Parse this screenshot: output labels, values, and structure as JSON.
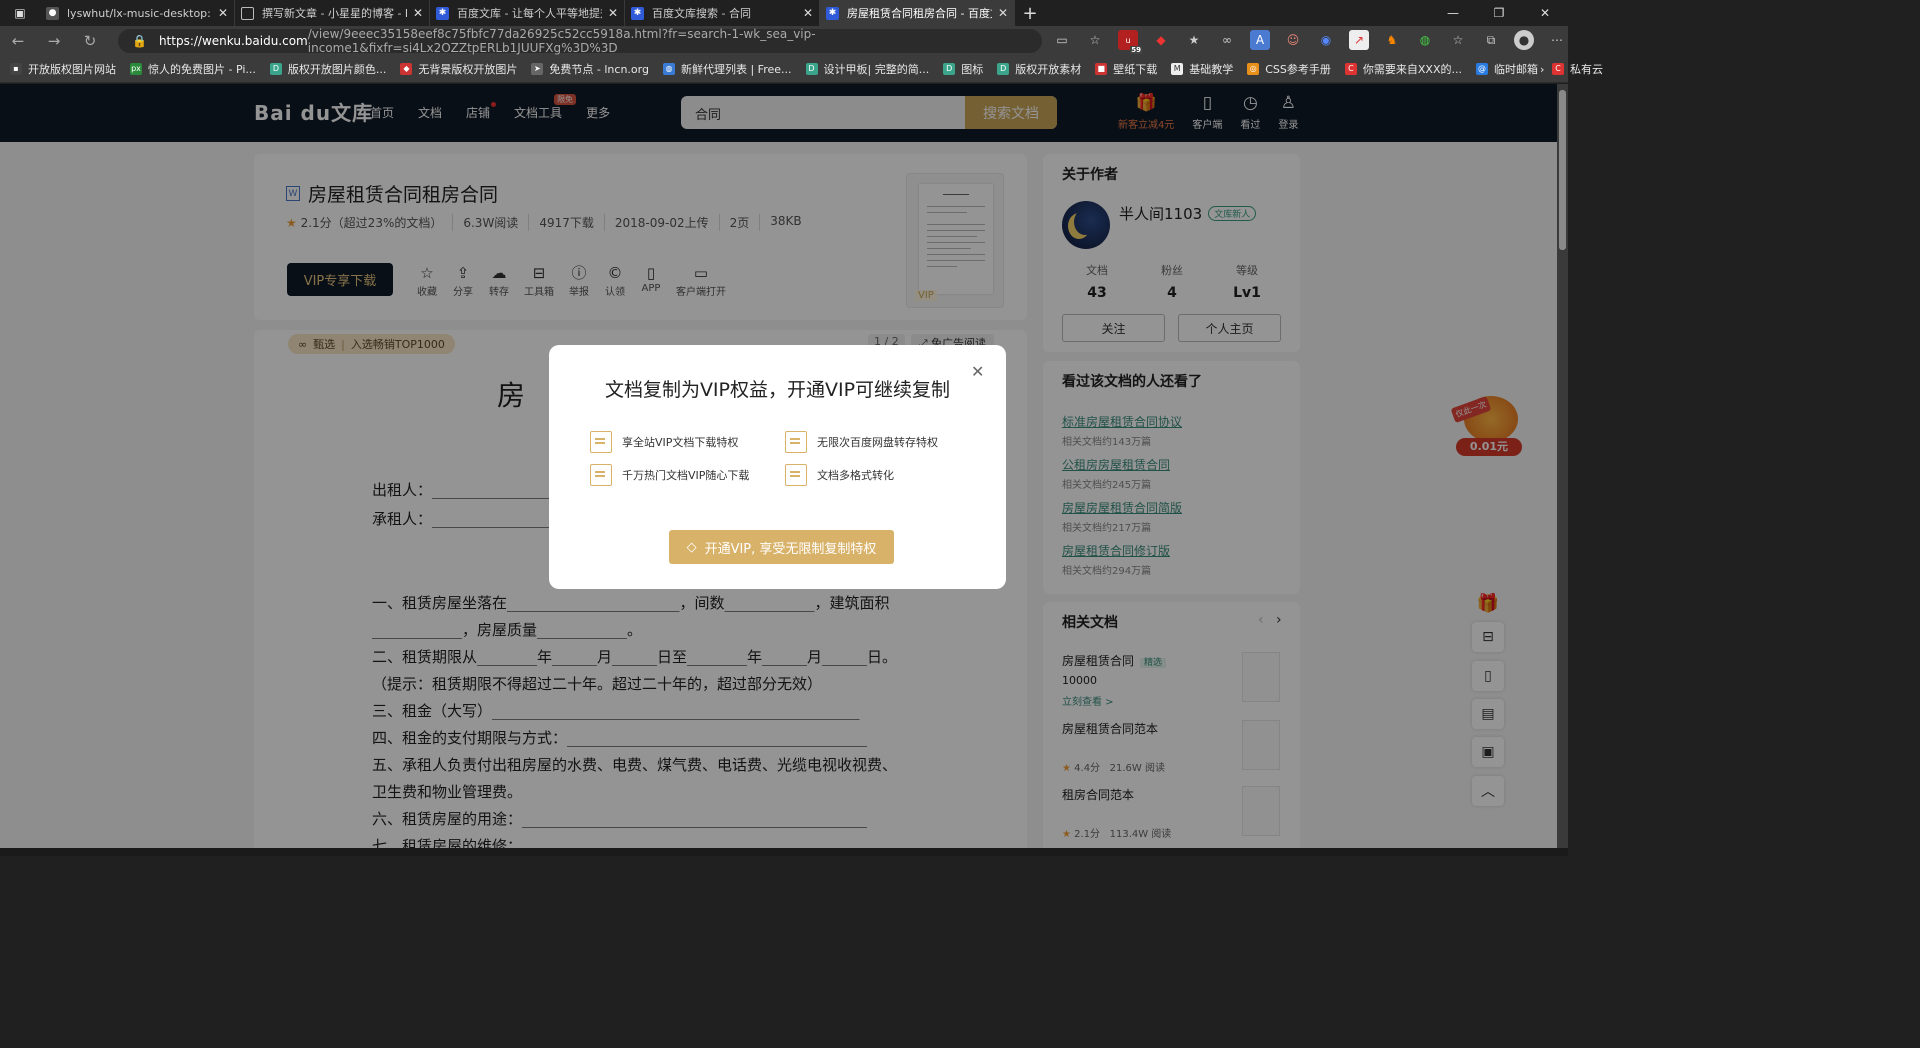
{
  "browser": {
    "tabs": [
      {
        "title": "lyswhut/lx-music-desktop: 一个基",
        "favicon": "github",
        "active": false
      },
      {
        "title": "撰写新文章 - 小星星的博客 - Pow",
        "favicon": "doc",
        "active": false
      },
      {
        "title": "百度文库 - 让每个人平等地提升自",
        "favicon": "baidu",
        "active": false
      },
      {
        "title": "百度文库搜索 - 合同",
        "favicon": "baidu",
        "active": false
      },
      {
        "title": "房屋租赁合同租房合同 - 百度文库",
        "favicon": "baidu",
        "active": true
      }
    ],
    "url_host": "https://wenku.baidu.com",
    "url_rest": "/view/9eeec35158eef8c75fbfc77da26925c52cc5918a.html?fr=search-1-wk_sea_vip-income1&fixfr=si4Lx2OZZtpERLb1JUUFXg%3D%3D",
    "extension_badge": "59",
    "bookmarks": [
      "开放版权图片网站",
      "惊人的免费图片 - Pi...",
      "版权开放图片颜色...",
      "无背景版权开放图片",
      "免费节点 - lncn.org",
      "新鲜代理列表 | Free...",
      "设计甲板| 完整的简...",
      "图标",
      "版权开放素材",
      "壁纸下载",
      "基础教学",
      "CSS参考手册",
      "你需要来自XXX的...",
      "临时邮箱",
      "私有云"
    ]
  },
  "site": {
    "logo": "Bai du文库",
    "nav": [
      "首页",
      "文档",
      "店铺",
      "文档工具",
      "更多"
    ],
    "nav_badge": "限免",
    "search_query": "合同",
    "search_button": "搜索文档",
    "right_nav": [
      "新客立减4元",
      "客户端",
      "看过",
      "登录"
    ]
  },
  "document": {
    "title": "房屋租赁合同租房合同",
    "meta": [
      "2.1分（超过23%的文档）",
      "6.3W阅读",
      "4917下载",
      "2018-09-02上传",
      "2页",
      "38KB"
    ],
    "vip_download": "VIP专享下载",
    "actions": [
      "收藏",
      "分享",
      "转存",
      "工具箱",
      "举报",
      "认领",
      "APP",
      "客户端打开"
    ],
    "thumb_tag": "VIP",
    "select_label": "甄选",
    "select_rank": "入选畅销TOP1000",
    "page_indicator": "1 / 2",
    "ad_free": "免广告阅读",
    "big_title": "房 屋",
    "lines": [
      "出租人：___________________",
      "承租人：___________________",
      "一、租赁房屋坐落在_______________________，间数____________，建筑面积",
      "____________，房屋质量____________。",
      "二、租赁期限从________年______月______日至________年______月______日。",
      "（提示：租赁期限不得超过二十年。超过二十年的，超过部分无效）",
      "三、租金（大写）_________________________________________________",
      "四、租金的支付期限与方式：________________________________________",
      "五、承租人负责付出租房屋的水费、电费、煤气费、电话费、光缆电视收视费、",
      "卫生费和物业管理费。",
      "六、租赁房屋的用途：______________________________________________",
      "七、租赁房屋的维修："
    ]
  },
  "author": {
    "heading": "关于作者",
    "name": "半人间1103",
    "tag": "文库新人",
    "stats": [
      {
        "label": "文档",
        "value": "43"
      },
      {
        "label": "粉丝",
        "value": "4"
      },
      {
        "label": "等级",
        "value": "Lv1"
      }
    ],
    "follow": "关注",
    "homepage": "个人主页"
  },
  "also_viewed": {
    "heading": "看过该文档的人还看了",
    "items": [
      {
        "title": "标准房屋租赁合同协议",
        "sub": "相关文档约143万篇"
      },
      {
        "title": "公租房房屋租赁合同",
        "sub": "相关文档约245万篇"
      },
      {
        "title": "房屋房屋租赁合同简版",
        "sub": "相关文档约217万篇"
      },
      {
        "title": "房屋租赁合同修订版",
        "sub": "相关文档约294万篇"
      }
    ]
  },
  "related": {
    "heading": "相关文档",
    "items": [
      {
        "title": "房屋租赁合同",
        "tag": "精选",
        "count": "10000",
        "link": "立刻查看 >"
      },
      {
        "title": "房屋租赁合同范本",
        "score": "4.4分",
        "reads": "21.6W 阅读"
      },
      {
        "title": "租房合同范本",
        "score": "2.1分",
        "reads": "113.4W 阅读"
      }
    ]
  },
  "promo": {
    "tag": "仅此一次",
    "price": "0.01元"
  },
  "modal": {
    "title": "文档复制为VIP权益，开通VIP可继续复制",
    "features": [
      "享全站VIP文档下载特权",
      "无限次百度网盘转存特权",
      "千万热门文档VIP随心下载",
      "文档多格式转化"
    ],
    "cta": "开通VIP, 享受无限制复制特权"
  },
  "colors": {
    "accent_gold": "#d9b269",
    "nav_dark": "#111a27",
    "link_green": "#3a8d7a"
  }
}
